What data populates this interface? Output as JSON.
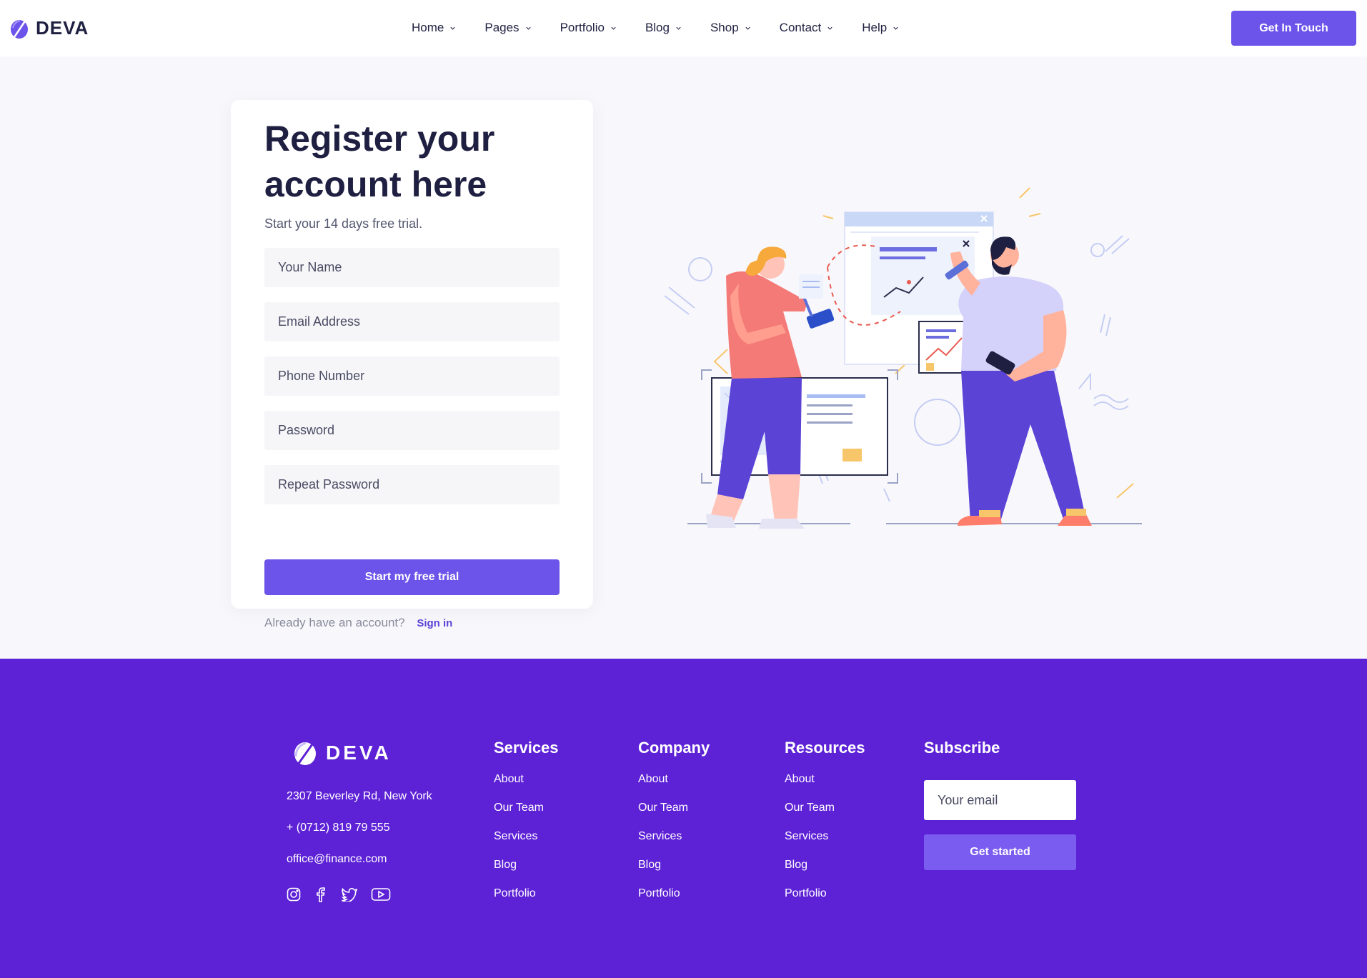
{
  "brand": {
    "name": "DEVA"
  },
  "nav": {
    "items": [
      {
        "label": "Home"
      },
      {
        "label": "Pages"
      },
      {
        "label": "Portfolio"
      },
      {
        "label": "Blog"
      },
      {
        "label": "Shop"
      },
      {
        "label": "Contact"
      },
      {
        "label": "Help"
      }
    ],
    "cta_label": "Get In Touch"
  },
  "form": {
    "title": "Register your account here",
    "subtitle": "Start your 14 days free trial.",
    "fields": [
      {
        "placeholder": "Your Name",
        "value": ""
      },
      {
        "placeholder": "Email Address",
        "value": ""
      },
      {
        "placeholder": "Phone Number",
        "value": ""
      },
      {
        "placeholder": "Password",
        "value": ""
      },
      {
        "placeholder": "Repeat Password",
        "value": ""
      }
    ],
    "submit_label": "Start my free trial",
    "signin_prompt": "Already have an account?",
    "signin_link": "Sign in"
  },
  "footer": {
    "brand": "DEVA",
    "address": "2307 Beverley Rd, New York",
    "phone": "+ (0712) 819 79 555",
    "email": "office@finance.com",
    "social_icons": [
      "instagram-icon",
      "facebook-icon",
      "twitter-icon",
      "youtube-icon"
    ],
    "columns": [
      {
        "title": "Services",
        "links": [
          "About",
          "Our Team",
          "Services",
          "Blog",
          "Portfolio"
        ]
      },
      {
        "title": "Company",
        "links": [
          "About",
          "Our Team",
          "Services",
          "Blog",
          "Portfolio"
        ]
      },
      {
        "title": "Resources",
        "links": [
          "About",
          "Our Team",
          "Services",
          "Blog",
          "Portfolio"
        ]
      }
    ],
    "subscribe": {
      "title": "Subscribe",
      "placeholder": "Your email",
      "button_label": "Get started"
    }
  },
  "colors": {
    "accent": "#6c54ea",
    "footer_bg": "#5e22d6",
    "hero_bg": "#f8f8fc",
    "text_dark": "#1f2041"
  }
}
